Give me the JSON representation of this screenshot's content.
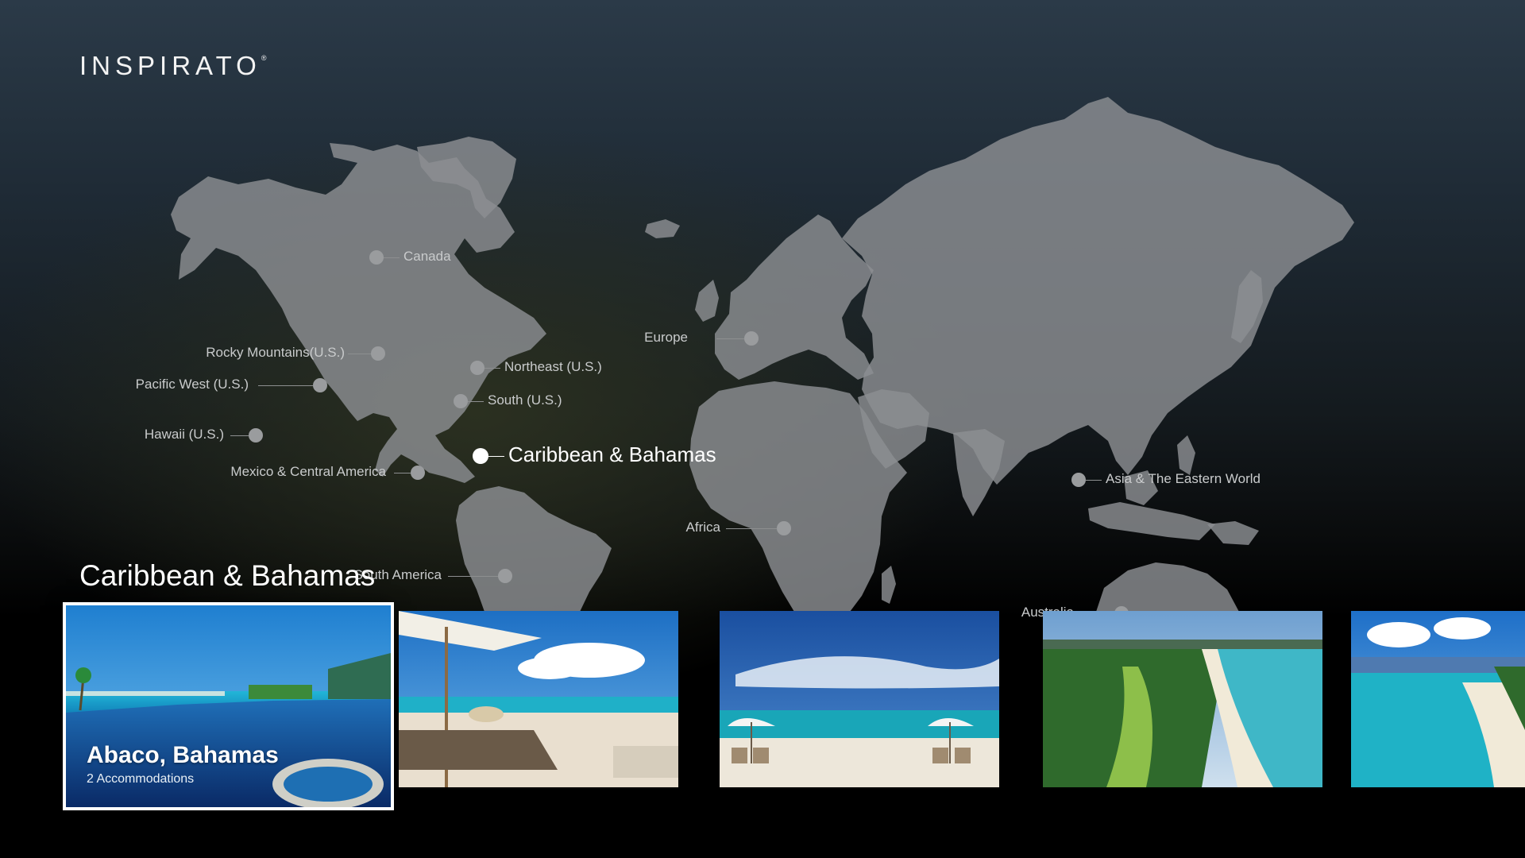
{
  "brand": {
    "logo_text": "INSPIRATO",
    "logo_mark": "®"
  },
  "map": {
    "regions": [
      {
        "label": "Canada",
        "active": false
      },
      {
        "label": "Rocky Mountains(U.S.)",
        "active": false
      },
      {
        "label": "Pacific West (U.S.)",
        "active": false
      },
      {
        "label": "Hawaii (U.S.)",
        "active": false
      },
      {
        "label": "Northeast (U.S.)",
        "active": false
      },
      {
        "label": "South (U.S.)",
        "active": false
      },
      {
        "label": "Mexico & Central America",
        "active": false
      },
      {
        "label": "Caribbean & Bahamas",
        "active": true
      },
      {
        "label": "Europe",
        "active": false
      },
      {
        "label": "Africa",
        "active": false
      },
      {
        "label": "South America",
        "active": false
      },
      {
        "label": "Asia & The Eastern World",
        "active": false
      },
      {
        "label": "Australia",
        "active": false
      }
    ]
  },
  "section": {
    "title": "Caribbean & Bahamas"
  },
  "destinations": [
    {
      "name": "Abaco, Bahamas",
      "subtitle": "2 Accommodations",
      "selected": true,
      "image": "infinity-pool-ocean"
    },
    {
      "name": "",
      "subtitle": "",
      "selected": false,
      "image": "beach-lounger-umbrella"
    },
    {
      "name": "",
      "subtitle": "",
      "selected": false,
      "image": "beach-umbrellas-chairs"
    },
    {
      "name": "",
      "subtitle": "",
      "selected": false,
      "image": "aerial-golf-beach"
    },
    {
      "name": "",
      "subtitle": "",
      "selected": false,
      "image": "aerial-turquoise-bay"
    }
  ],
  "colors": {
    "background_top": "#2b3a48",
    "background_bottom": "#000000",
    "land": "#8c8f92",
    "pin": "#9a9c9e",
    "active_pin": "#ffffff"
  }
}
